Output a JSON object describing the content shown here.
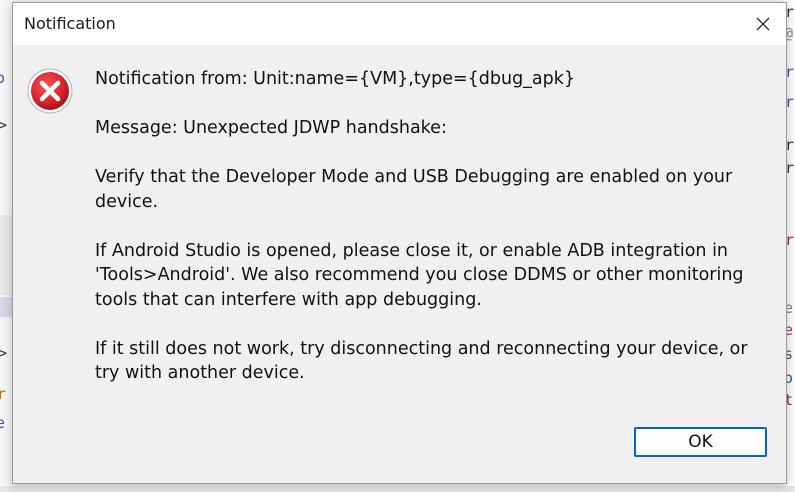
{
  "dialog": {
    "title": "Notification",
    "icon": "error-icon",
    "lines": [
      "Notification from: Unit:name={VM},type={dbug_apk}",
      "Message: Unexpected JDWP handshake:",
      "Verify that the Developer Mode and USB Debugging are enabled on your device.",
      "If Android Studio is opened, please close it, or enable ADB integration in 'Tools>Android'. We also recommend you close DDMS or other monitoring tools that can interfere with app debugging.",
      "If it still does not work, try disconnecting and reconnecting your device, or try with another device."
    ],
    "ok_label": "OK"
  },
  "colors": {
    "error_red": "#d8232a",
    "button_border": "#0067c0",
    "dialog_bg": "#f0f0f0",
    "titlebar_bg": "#ffffff"
  }
}
